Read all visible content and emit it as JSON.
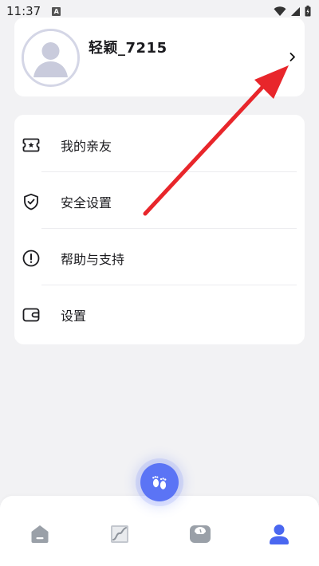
{
  "status_bar": {
    "time": "11:37",
    "notification_icon": "A"
  },
  "profile": {
    "username": "轻颖_7215",
    "avatar_icon": "default-avatar-icon",
    "chevron_icon": "chevron-right-icon"
  },
  "menu": {
    "items": [
      {
        "label": "我的亲友",
        "icon": "ticket-icon"
      },
      {
        "label": "安全设置",
        "icon": "shield-check-icon"
      },
      {
        "label": "帮助与支持",
        "icon": "alert-circle-icon"
      },
      {
        "label": "设置",
        "icon": "wallet-icon"
      }
    ]
  },
  "bottom_nav": {
    "items": [
      {
        "icon": "home-icon"
      },
      {
        "icon": "chart-icon"
      },
      {
        "icon": "scale-icon"
      },
      {
        "icon": "profile-icon",
        "active": true
      }
    ],
    "fab_icon": "footprints-icon"
  },
  "colors": {
    "accent": "#5b74f5",
    "active_nav": "#4a67f0",
    "inactive_nav": "#9aa0a8",
    "annotation": "#e8262b",
    "background": "#f2f2f4"
  }
}
